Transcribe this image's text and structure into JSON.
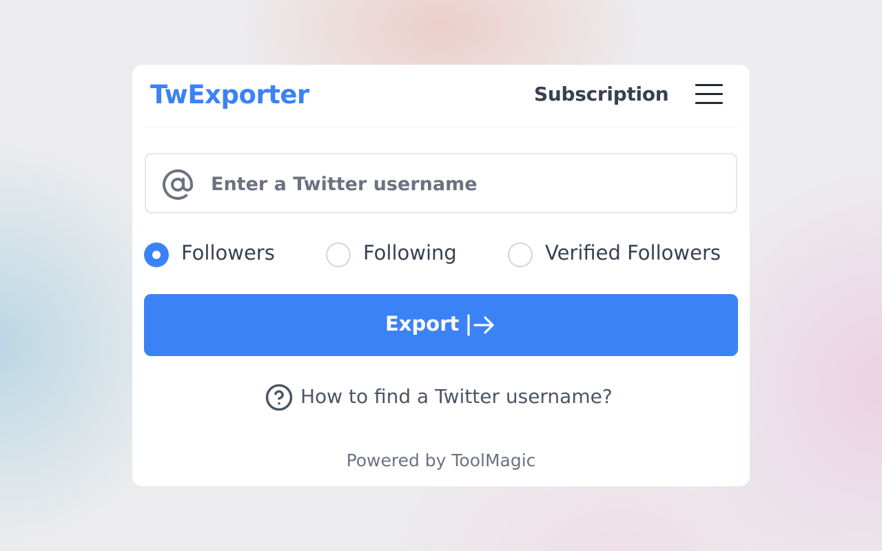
{
  "header": {
    "brand": "TwExporter",
    "subscription_label": "Subscription",
    "menu_icon": "hamburger-menu-icon"
  },
  "search": {
    "icon": "at-sign-icon",
    "placeholder": "Enter a Twitter username",
    "value": ""
  },
  "options": [
    {
      "label": "Followers",
      "checked": true
    },
    {
      "label": "Following",
      "checked": false
    },
    {
      "label": "Verified Followers",
      "checked": false
    }
  ],
  "export": {
    "label": "Export",
    "icon": "export-arrow-icon"
  },
  "help": {
    "icon": "question-circle-icon",
    "label": "How to find a Twitter username?"
  },
  "footer": {
    "powered_by": "Powered by ToolMagic"
  },
  "colors": {
    "accent": "#3b82f6",
    "text": "#374151",
    "muted": "#6b7280"
  }
}
